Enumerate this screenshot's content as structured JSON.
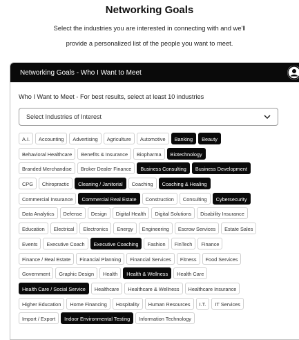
{
  "page": {
    "title": "Networking Goals",
    "intro_line1": "Select the industries you are interested in connecting with and we'll",
    "intro_line2": "provide a personalized list of the people you want to meet."
  },
  "card": {
    "header_title": "Networking Goals - Who I Want to Meet",
    "prompt": "Who I Want to Meet - For best results, select at least 10 industries",
    "select_placeholder": "Select Industries of Interest"
  },
  "industries": [
    {
      "label": "A.I.",
      "selected": false
    },
    {
      "label": "Accounting",
      "selected": false
    },
    {
      "label": "Advertising",
      "selected": false
    },
    {
      "label": "Agriculture",
      "selected": false
    },
    {
      "label": "Automotive",
      "selected": false
    },
    {
      "label": "Banking",
      "selected": true
    },
    {
      "label": "Beauty",
      "selected": true
    },
    {
      "label": "Behavioral Healthcare",
      "selected": false
    },
    {
      "label": "Benefits & Insurance",
      "selected": false
    },
    {
      "label": "Biopharma",
      "selected": false
    },
    {
      "label": "Biotechnology",
      "selected": true
    },
    {
      "label": "Branded Merchandise",
      "selected": false
    },
    {
      "label": "Broker Dealer Finance",
      "selected": false
    },
    {
      "label": "Business Consulting",
      "selected": true
    },
    {
      "label": "Business Development",
      "selected": true
    },
    {
      "label": "CPG",
      "selected": false
    },
    {
      "label": "Chiropractic",
      "selected": false
    },
    {
      "label": "Cleaning / Janitorial",
      "selected": true
    },
    {
      "label": "Coaching",
      "selected": false
    },
    {
      "label": "Coaching & Healing",
      "selected": true
    },
    {
      "label": "Commercial Insurance",
      "selected": false
    },
    {
      "label": "Commercial Real Estate",
      "selected": true
    },
    {
      "label": "Construction",
      "selected": false
    },
    {
      "label": "Consulting",
      "selected": false
    },
    {
      "label": "Cybersecurity",
      "selected": true
    },
    {
      "label": "Data Analytics",
      "selected": false
    },
    {
      "label": "Defense",
      "selected": false
    },
    {
      "label": "Design",
      "selected": false
    },
    {
      "label": "Digital Health",
      "selected": false
    },
    {
      "label": "Digital Solutions",
      "selected": false
    },
    {
      "label": "Disability Insurance",
      "selected": false
    },
    {
      "label": "Education",
      "selected": false
    },
    {
      "label": "Electrical",
      "selected": false
    },
    {
      "label": "Electronics",
      "selected": false
    },
    {
      "label": "Energy",
      "selected": false
    },
    {
      "label": "Engineering",
      "selected": false
    },
    {
      "label": "Escrow Services",
      "selected": false
    },
    {
      "label": "Estate Sales",
      "selected": false
    },
    {
      "label": "Events",
      "selected": false
    },
    {
      "label": "Executive Coach",
      "selected": false
    },
    {
      "label": "Executive Coaching",
      "selected": true
    },
    {
      "label": "Fashion",
      "selected": false
    },
    {
      "label": "FinTech",
      "selected": false
    },
    {
      "label": "Finance",
      "selected": false
    },
    {
      "label": "Finance / Real Estate",
      "selected": false
    },
    {
      "label": "Financial Planning",
      "selected": false
    },
    {
      "label": "Financial Services",
      "selected": false
    },
    {
      "label": "Fitness",
      "selected": false
    },
    {
      "label": "Food Services",
      "selected": false
    },
    {
      "label": "Government",
      "selected": false
    },
    {
      "label": "Graphic Design",
      "selected": false
    },
    {
      "label": "Health",
      "selected": false
    },
    {
      "label": "Health & Wellness",
      "selected": true
    },
    {
      "label": "Health Care",
      "selected": false
    },
    {
      "label": "Health Care / Social Service",
      "selected": true
    },
    {
      "label": "Healthcare",
      "selected": false
    },
    {
      "label": "Healthcare & Wellness",
      "selected": false
    },
    {
      "label": "Healthcare Insurance",
      "selected": false
    },
    {
      "label": "Higher Education",
      "selected": false
    },
    {
      "label": "Home Financing",
      "selected": false
    },
    {
      "label": "Hospitality",
      "selected": false
    },
    {
      "label": "Human Resources",
      "selected": false
    },
    {
      "label": "I.T.",
      "selected": false
    },
    {
      "label": "IT Services",
      "selected": false
    },
    {
      "label": "Import / Export",
      "selected": false
    },
    {
      "label": "Indoor Environmental Testing",
      "selected": true
    },
    {
      "label": "Information Technology",
      "selected": false
    }
  ],
  "icons": {
    "profile": "user-circle-icon",
    "dropdown": "chevron-down-icon"
  },
  "colors": {
    "selected_bg": "#0a0a0a",
    "selected_text": "#ffffff",
    "header_bg": "#0a0a0a"
  }
}
